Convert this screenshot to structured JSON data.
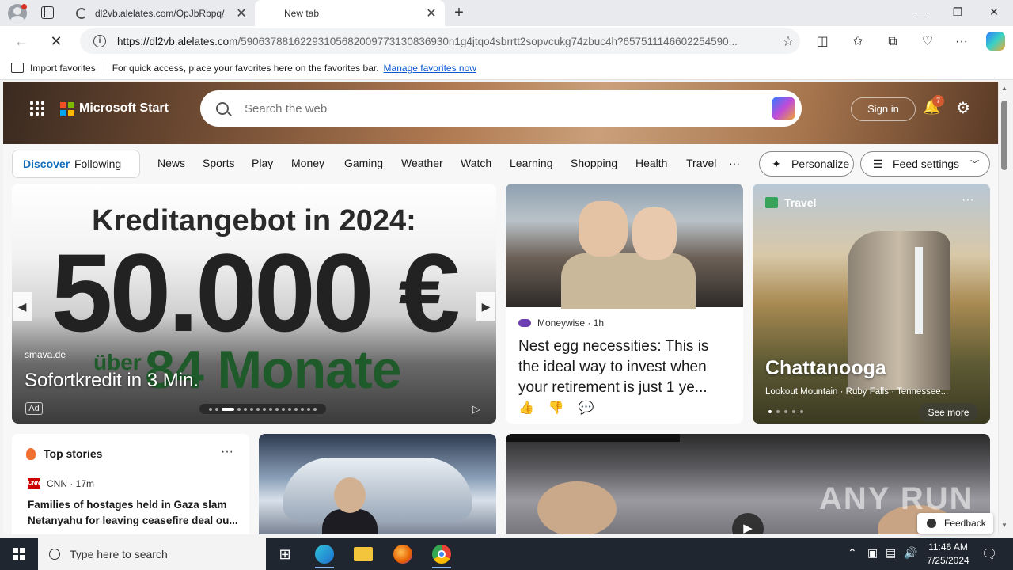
{
  "browser": {
    "tabs": [
      {
        "title": "dl2vb.alelates.com/OpJbRbpq/",
        "close": "✕"
      },
      {
        "title": "New tab",
        "close": "✕"
      }
    ],
    "new_tab": "+",
    "window_controls": {
      "minimize": "—",
      "restore": "❐",
      "close": "✕"
    },
    "address": {
      "host": "https://dl2vb.alelates.com",
      "path": "/59063788162293105682009773130836930n1g4jtqo4sbrrtt2sopvcukg74zbuc4h?657511146602254590..."
    },
    "favorites_bar": {
      "import_label": "Import favorites",
      "hint": "For quick access, place your favorites here on the favorites bar.",
      "manage_link": "Manage favorites now"
    }
  },
  "msstart": {
    "brand": "Microsoft Start",
    "search_placeholder": "Search the web",
    "sign_in": "Sign in",
    "notification_count": "7",
    "segments": {
      "discover": "Discover",
      "following": "Following"
    },
    "nav_links": [
      "News",
      "Sports",
      "Play",
      "Money",
      "Gaming",
      "Weather",
      "Watch",
      "Learning",
      "Shopping",
      "Health",
      "Travel",
      "···"
    ],
    "personalize": "Personalize",
    "feed_settings": "Feed settings"
  },
  "cards": {
    "ad": {
      "headline": "Kreditangebot in 2024:",
      "amount": "50.000 €",
      "green_small": "über",
      "green_big": "84 Monate",
      "source": "smava.de",
      "title": "Sofortkredit in 3 Min.",
      "tag": "Ad"
    },
    "nest": {
      "source": "Moneywise · 1h",
      "title": "Nest egg necessities: This is the ideal way to invest when your retirement is just 1 ye..."
    },
    "travel": {
      "category": "Travel",
      "title": "Chattanooga",
      "subtitle": "Lookout Mountain · Ruby Falls · Tennessee...",
      "see_more": "See more"
    },
    "top_stories": {
      "heading": "Top stories",
      "source": "CNN · 17m",
      "cnn_logo": "CNN",
      "title": "Families of hostages held in Gaza slam Netanyahu for leaving ceasefire deal ou..."
    },
    "feedback": "Feedback",
    "watermark": "ANY RUN"
  },
  "taskbar": {
    "search_placeholder": "Type here to search",
    "time": "11:46 AM",
    "date": "7/25/2024"
  }
}
